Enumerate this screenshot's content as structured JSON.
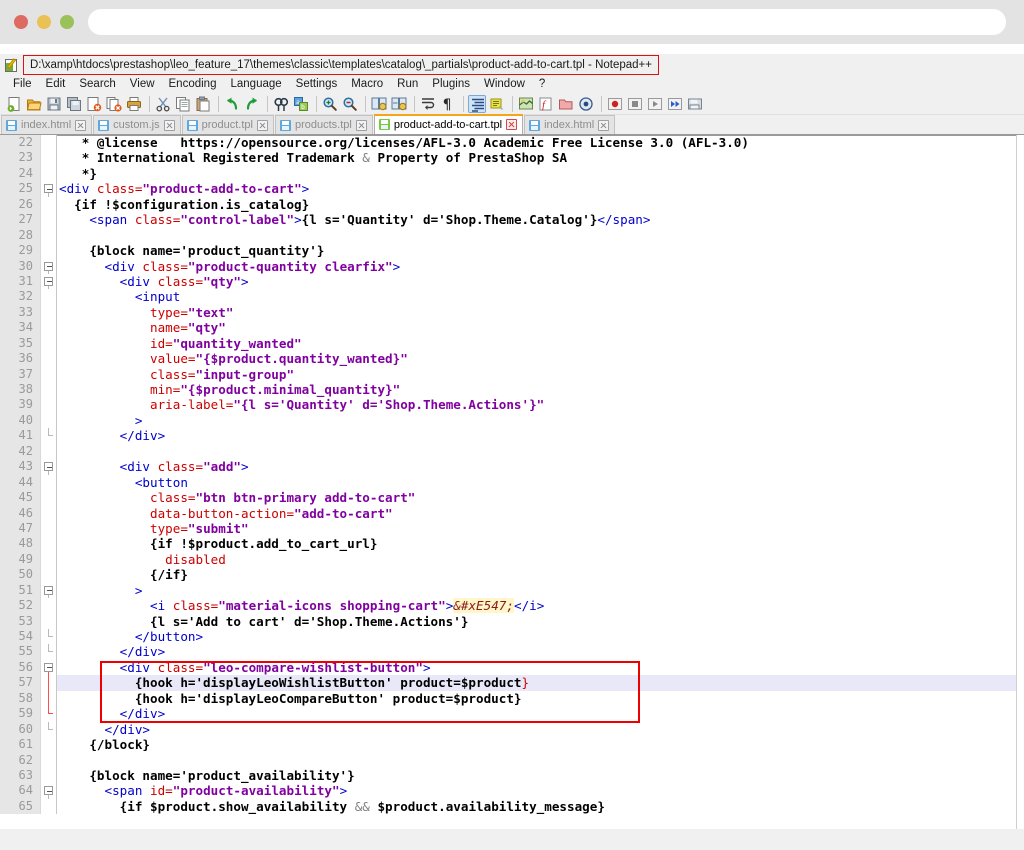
{
  "window": {
    "traffic_lights": [
      "close",
      "minimize",
      "maximize"
    ],
    "url_value": "",
    "url_placeholder": ""
  },
  "app": {
    "title": "D:\\xamp\\htdocs\\prestashop\\leo_feature_17\\themes\\classic\\templates\\catalog\\_partials\\product-add-to-cart.tpl - Notepad++",
    "logo_name": "notepad-plus-plus-icon",
    "title_highlight_color": "#e01010"
  },
  "menu": {
    "items": [
      "File",
      "Edit",
      "Search",
      "View",
      "Encoding",
      "Language",
      "Settings",
      "Macro",
      "Run",
      "Plugins",
      "Window",
      "?"
    ]
  },
  "toolbar": {
    "groups": [
      [
        "new-file-icon",
        "open-file-icon",
        "save-icon",
        "save-all-icon",
        "close-file-icon",
        "close-all-files-icon",
        "print-icon"
      ],
      [
        "cut-icon",
        "copy-icon",
        "paste-icon"
      ],
      [
        "undo-icon",
        "redo-icon"
      ],
      [
        "find-icon",
        "replace-icon"
      ],
      [
        "zoom-in-icon",
        "zoom-out-icon"
      ],
      [
        "sync-vertical-scroll-icon",
        "sync-horizontal-scroll-icon"
      ],
      [
        "word-wrap-icon",
        "show-all-characters-icon"
      ],
      [
        "show-indent-guide-icon",
        "user-defined-language-icon"
      ],
      [
        "document-map-icon",
        "function-list-icon",
        "folder-as-workspace-icon",
        "monitoring-icon"
      ],
      [
        "record-macro-icon",
        "stop-recording-icon",
        "playback-macro-icon",
        "run-macro-multiple-icon",
        "save-macro-icon"
      ]
    ],
    "selected_icon": "show-indent-guide-icon"
  },
  "tabs": {
    "items": [
      {
        "label": "index.html",
        "active": false
      },
      {
        "label": "custom.js",
        "active": false
      },
      {
        "label": "product.tpl",
        "active": false
      },
      {
        "label": "products.tpl",
        "active": false
      },
      {
        "label": "product-add-to-cart.tpl",
        "active": true
      },
      {
        "label": "index.html",
        "active": false
      }
    ],
    "active_accent_color": "#f5a51d"
  },
  "editor": {
    "first_line": 22,
    "current_line": 57,
    "annotation_color": "#ee0000",
    "current_line_highlight": "#e8e8f8",
    "lines": [
      {
        "n": 22,
        "fold": "none",
        "tokens": [
          {
            "t": "   * @license   https://opensource.org/licenses/AFL-3.0 Academic Free License 3.0 (AFL-3.0)",
            "c": "c-plain"
          }
        ]
      },
      {
        "n": 23,
        "fold": "none",
        "tokens": [
          {
            "t": "   * International Registered Trademark ",
            "c": "c-plain"
          },
          {
            "t": "&",
            "c": "c-amp"
          },
          {
            "t": " Property of PrestaShop SA",
            "c": "c-plain"
          }
        ]
      },
      {
        "n": 24,
        "fold": "none",
        "tokens": [
          {
            "t": "   *}",
            "c": "c-plain"
          }
        ]
      },
      {
        "n": 25,
        "fold": "box",
        "tokens": [
          {
            "t": "<div",
            "c": "c-tag"
          },
          {
            "t": " class=",
            "c": "c-attr"
          },
          {
            "t": "\"product-add-to-cart\"",
            "c": "c-val"
          },
          {
            "t": ">",
            "c": "c-tag"
          }
        ]
      },
      {
        "n": 26,
        "fold": "none",
        "tokens": [
          {
            "t": "  {if !$configuration.is_catalog}",
            "c": "c-smarty"
          }
        ]
      },
      {
        "n": 27,
        "fold": "none",
        "tokens": [
          {
            "t": "    ",
            "c": "c-plain"
          },
          {
            "t": "<span",
            "c": "c-tag"
          },
          {
            "t": " class=",
            "c": "c-attr"
          },
          {
            "t": "\"control-label\"",
            "c": "c-val"
          },
          {
            "t": ">",
            "c": "c-tag"
          },
          {
            "t": "{l s='Quantity' d='Shop.Theme.Catalog'}",
            "c": "c-smarty"
          },
          {
            "t": "</span>",
            "c": "c-tag"
          }
        ]
      },
      {
        "n": 28,
        "fold": "none",
        "tokens": []
      },
      {
        "n": 29,
        "fold": "none",
        "tokens": [
          {
            "t": "    {block name='product_quantity'}",
            "c": "c-smarty"
          }
        ]
      },
      {
        "n": 30,
        "fold": "box",
        "tokens": [
          {
            "t": "      ",
            "c": "c-plain"
          },
          {
            "t": "<div",
            "c": "c-tag"
          },
          {
            "t": " class=",
            "c": "c-attr"
          },
          {
            "t": "\"product-quantity clearfix\"",
            "c": "c-val"
          },
          {
            "t": ">",
            "c": "c-tag"
          }
        ]
      },
      {
        "n": 31,
        "fold": "box",
        "tokens": [
          {
            "t": "        ",
            "c": "c-plain"
          },
          {
            "t": "<div",
            "c": "c-tag"
          },
          {
            "t": " class=",
            "c": "c-attr"
          },
          {
            "t": "\"qty\"",
            "c": "c-val"
          },
          {
            "t": ">",
            "c": "c-tag"
          }
        ]
      },
      {
        "n": 32,
        "fold": "none",
        "tokens": [
          {
            "t": "          ",
            "c": "c-plain"
          },
          {
            "t": "<input",
            "c": "c-tag"
          }
        ]
      },
      {
        "n": 33,
        "fold": "none",
        "tokens": [
          {
            "t": "            type=",
            "c": "c-attr"
          },
          {
            "t": "\"text\"",
            "c": "c-val"
          }
        ]
      },
      {
        "n": 34,
        "fold": "none",
        "tokens": [
          {
            "t": "            name=",
            "c": "c-attr"
          },
          {
            "t": "\"qty\"",
            "c": "c-val"
          }
        ]
      },
      {
        "n": 35,
        "fold": "none",
        "tokens": [
          {
            "t": "            id=",
            "c": "c-attr"
          },
          {
            "t": "\"quantity_wanted\"",
            "c": "c-val"
          }
        ]
      },
      {
        "n": 36,
        "fold": "none",
        "tokens": [
          {
            "t": "            value=",
            "c": "c-attr"
          },
          {
            "t": "\"{$product.quantity_wanted}\"",
            "c": "c-val"
          }
        ]
      },
      {
        "n": 37,
        "fold": "none",
        "tokens": [
          {
            "t": "            class=",
            "c": "c-attr"
          },
          {
            "t": "\"input-group\"",
            "c": "c-val"
          }
        ]
      },
      {
        "n": 38,
        "fold": "none",
        "tokens": [
          {
            "t": "            min=",
            "c": "c-attr"
          },
          {
            "t": "\"{$product.minimal_quantity}\"",
            "c": "c-val"
          }
        ]
      },
      {
        "n": 39,
        "fold": "none",
        "tokens": [
          {
            "t": "            aria-label=",
            "c": "c-attr"
          },
          {
            "t": "\"{l s='Quantity' d='Shop.Theme.Actions'}\"",
            "c": "c-val"
          }
        ]
      },
      {
        "n": 40,
        "fold": "none",
        "tokens": [
          {
            "t": "          >",
            "c": "c-tag"
          }
        ]
      },
      {
        "n": 41,
        "fold": "end",
        "tokens": [
          {
            "t": "        ",
            "c": "c-plain"
          },
          {
            "t": "</div>",
            "c": "c-tag"
          }
        ]
      },
      {
        "n": 42,
        "fold": "none",
        "tokens": []
      },
      {
        "n": 43,
        "fold": "box",
        "tokens": [
          {
            "t": "        ",
            "c": "c-plain"
          },
          {
            "t": "<div",
            "c": "c-tag"
          },
          {
            "t": " class=",
            "c": "c-attr"
          },
          {
            "t": "\"add\"",
            "c": "c-val"
          },
          {
            "t": ">",
            "c": "c-tag"
          }
        ]
      },
      {
        "n": 44,
        "fold": "none",
        "tokens": [
          {
            "t": "          ",
            "c": "c-plain"
          },
          {
            "t": "<button",
            "c": "c-tag"
          }
        ]
      },
      {
        "n": 45,
        "fold": "none",
        "tokens": [
          {
            "t": "            class=",
            "c": "c-attr"
          },
          {
            "t": "\"btn btn-primary add-to-cart\"",
            "c": "c-val"
          }
        ]
      },
      {
        "n": 46,
        "fold": "none",
        "tokens": [
          {
            "t": "            data-button-action=",
            "c": "c-attr"
          },
          {
            "t": "\"add-to-cart\"",
            "c": "c-val"
          }
        ]
      },
      {
        "n": 47,
        "fold": "none",
        "tokens": [
          {
            "t": "            type=",
            "c": "c-attr"
          },
          {
            "t": "\"submit\"",
            "c": "c-val"
          }
        ]
      },
      {
        "n": 48,
        "fold": "none",
        "tokens": [
          {
            "t": "            {if !$product.add_to_cart_url}",
            "c": "c-smarty"
          }
        ]
      },
      {
        "n": 49,
        "fold": "none",
        "tokens": [
          {
            "t": "              disabled",
            "c": "c-attr"
          }
        ]
      },
      {
        "n": 50,
        "fold": "none",
        "tokens": [
          {
            "t": "            {/if}",
            "c": "c-smarty"
          }
        ]
      },
      {
        "n": 51,
        "fold": "box",
        "tokens": [
          {
            "t": "          >",
            "c": "c-tag"
          }
        ]
      },
      {
        "n": 52,
        "fold": "none",
        "tokens": [
          {
            "t": "            ",
            "c": "c-plain"
          },
          {
            "t": "<i",
            "c": "c-tag"
          },
          {
            "t": " class=",
            "c": "c-attr"
          },
          {
            "t": "\"material-icons shopping-cart\"",
            "c": "c-val"
          },
          {
            "t": ">",
            "c": "c-tag"
          },
          {
            "t": "&#xE547;",
            "c": "c-ent"
          },
          {
            "t": "</i>",
            "c": "c-tag"
          }
        ]
      },
      {
        "n": 53,
        "fold": "none",
        "tokens": [
          {
            "t": "            {l s='Add to cart' d='Shop.Theme.Actions'}",
            "c": "c-smarty"
          }
        ]
      },
      {
        "n": 54,
        "fold": "end",
        "tokens": [
          {
            "t": "          ",
            "c": "c-plain"
          },
          {
            "t": "</button>",
            "c": "c-tag"
          }
        ]
      },
      {
        "n": 55,
        "fold": "end",
        "tokens": [
          {
            "t": "        ",
            "c": "c-plain"
          },
          {
            "t": "</div>",
            "c": "c-tag"
          }
        ]
      },
      {
        "n": 56,
        "fold": "box-red",
        "tokens": [
          {
            "t": "        ",
            "c": "c-plain"
          },
          {
            "t": "<div",
            "c": "c-tag"
          },
          {
            "t": " class=",
            "c": "c-attr"
          },
          {
            "t": "\"leo-compare-wishlist-button\"",
            "c": "c-val"
          },
          {
            "t": ">",
            "c": "c-tag"
          }
        ]
      },
      {
        "n": 57,
        "fold": "line-red",
        "current": true,
        "tokens": [
          {
            "t": "          {hook h='displayLeoWishlistButton' product=$product",
            "c": "c-smarty"
          },
          {
            "t": "}",
            "c": "c-brace"
          }
        ]
      },
      {
        "n": 58,
        "fold": "line-red",
        "tokens": [
          {
            "t": "          {hook h='displayLeoCompareButton' product=$product}",
            "c": "c-smarty"
          }
        ]
      },
      {
        "n": 59,
        "fold": "end-red",
        "tokens": [
          {
            "t": "        ",
            "c": "c-plain"
          },
          {
            "t": "</div>",
            "c": "c-tag"
          }
        ]
      },
      {
        "n": 60,
        "fold": "end",
        "tokens": [
          {
            "t": "      ",
            "c": "c-plain"
          },
          {
            "t": "</div>",
            "c": "c-tag"
          }
        ]
      },
      {
        "n": 61,
        "fold": "none",
        "tokens": [
          {
            "t": "    {/block}",
            "c": "c-smarty"
          }
        ]
      },
      {
        "n": 62,
        "fold": "none",
        "tokens": []
      },
      {
        "n": 63,
        "fold": "none",
        "tokens": [
          {
            "t": "    {block name='product_availability'}",
            "c": "c-smarty"
          }
        ]
      },
      {
        "n": 64,
        "fold": "box",
        "tokens": [
          {
            "t": "      ",
            "c": "c-plain"
          },
          {
            "t": "<span",
            "c": "c-tag"
          },
          {
            "t": " id=",
            "c": "c-attr"
          },
          {
            "t": "\"product-availability\"",
            "c": "c-val"
          },
          {
            "t": ">",
            "c": "c-tag"
          }
        ]
      },
      {
        "n": 65,
        "fold": "none",
        "tokens": [
          {
            "t": "        {if $product.show_availability ",
            "c": "c-smarty"
          },
          {
            "t": "&&",
            "c": "c-amp"
          },
          {
            "t": " $product.availability_message}",
            "c": "c-smarty"
          }
        ]
      }
    ]
  }
}
